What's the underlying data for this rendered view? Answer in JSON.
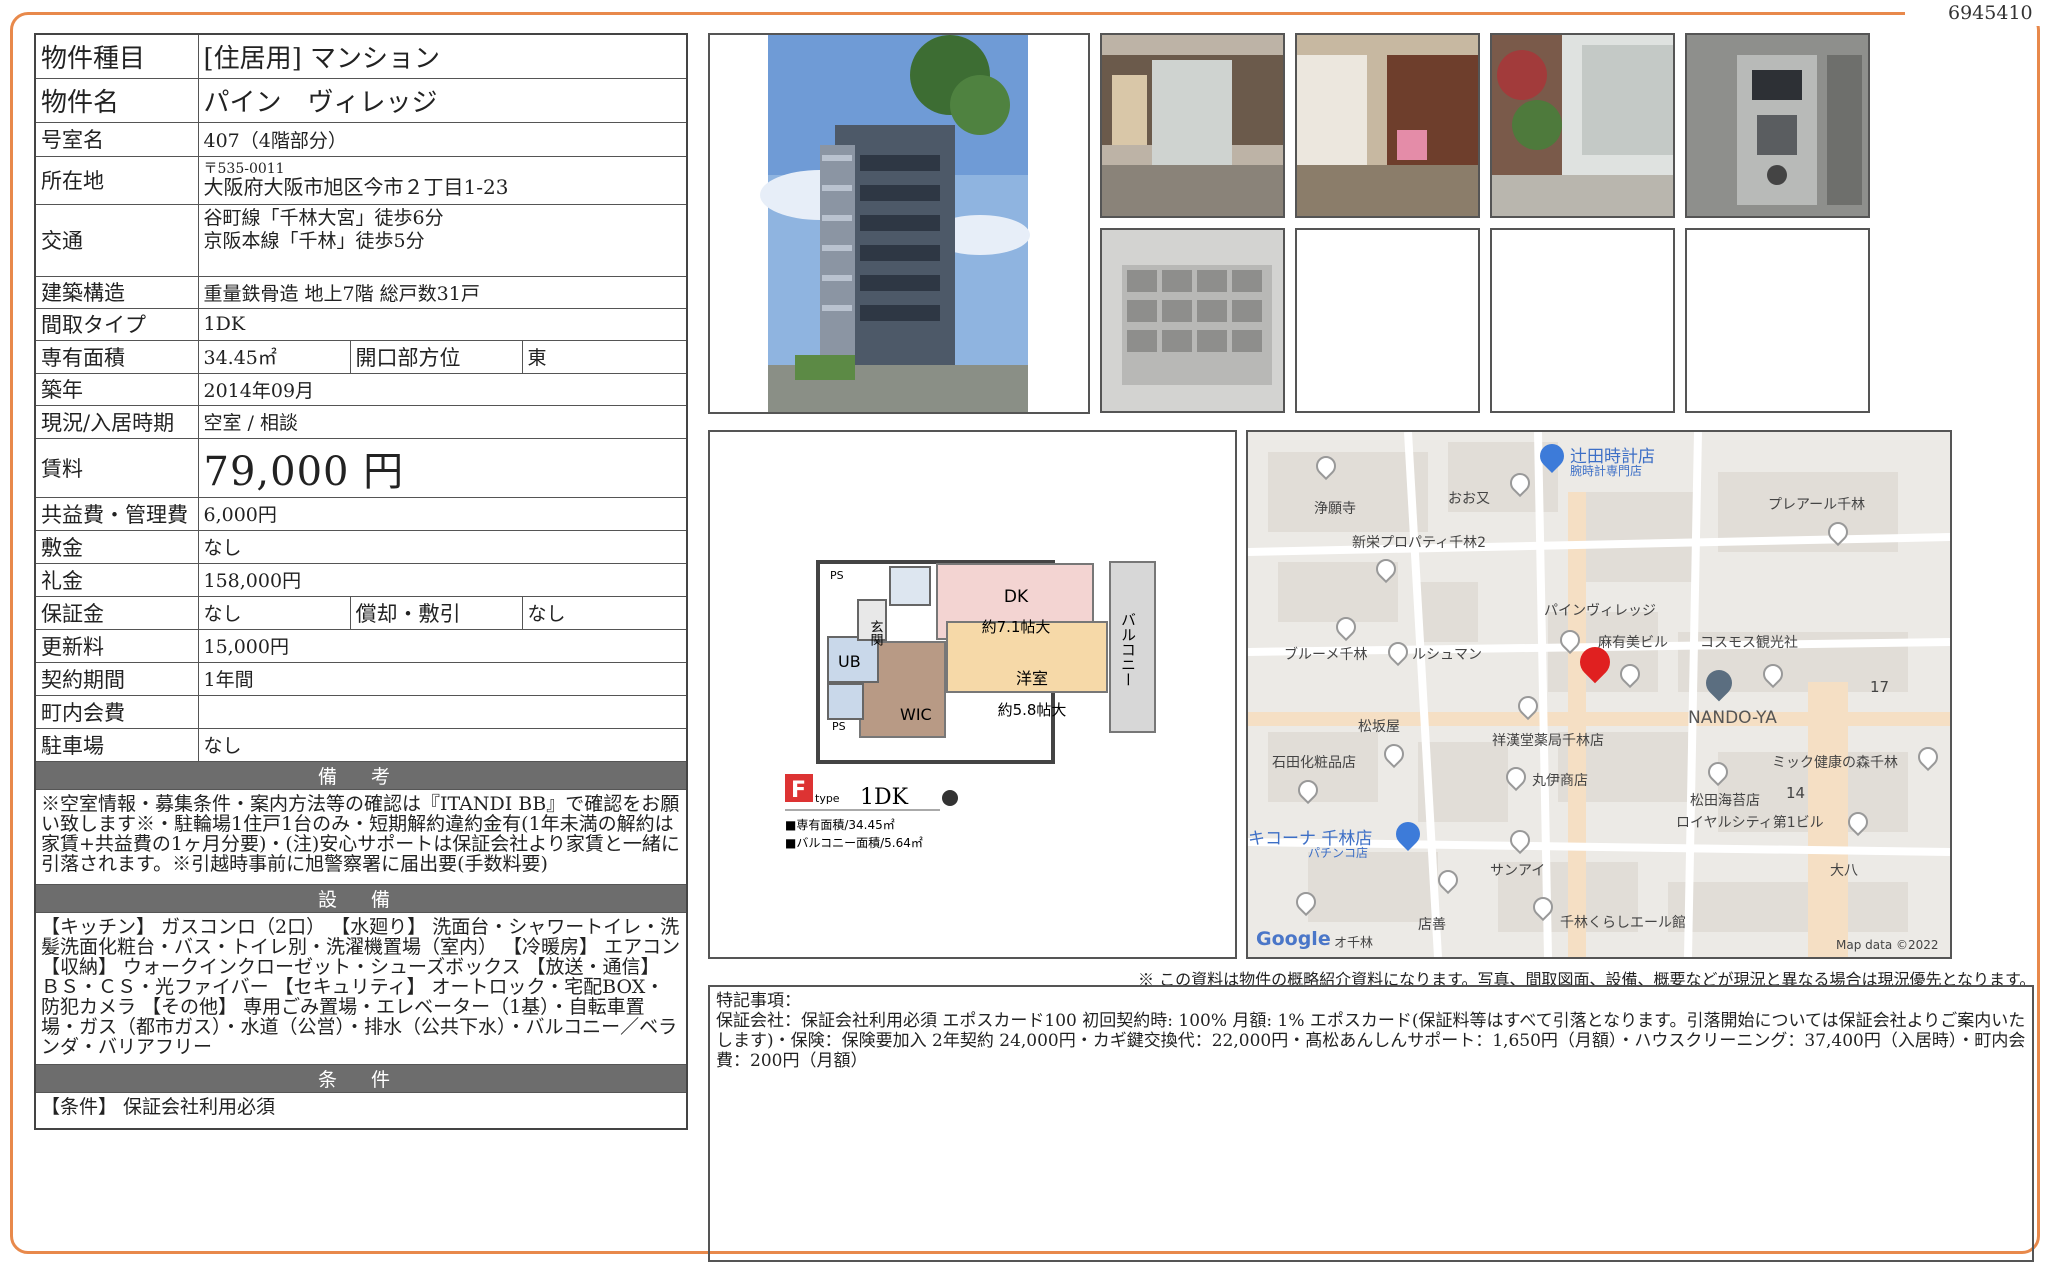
{
  "doc_number": "6945410",
  "spec": {
    "type_label": "物件種目",
    "type_value": "[住居用] マンション",
    "name_label": "物件名",
    "name_value": "パイン　ヴィレッジ",
    "room_label": "号室名",
    "room_value": "407（4階部分）",
    "address_label": "所在地",
    "postal": "〒535-0011",
    "address": "大阪府大阪市旭区今市２丁目1-23",
    "access_label": "交通",
    "access_1": "谷町線「千林大宮」徒歩6分",
    "access_2": "京阪本線「千林」徒歩5分",
    "structure_label": "建築構造",
    "structure_value": "重量鉄骨造 地上7階 総戸数31戸",
    "layout_label": "間取タイプ",
    "layout_value": "1DK",
    "area_label": "専有面積",
    "area_value": "34.45㎡",
    "direction_label": "開口部方位",
    "direction_value": "東",
    "built_label": "築年",
    "built_value": "2014年09月",
    "status_label": "現況/入居時期",
    "status_value": "空室 /  相談",
    "rent_label": "賃料",
    "rent_value": "79,000 円",
    "fee_label": "共益費・管理費",
    "fee_value": "6,000円",
    "deposit_label": "敷金",
    "deposit_value": "なし",
    "key_money_label": "礼金",
    "key_money_value": "158,000円",
    "guarantee_label": "保証金",
    "guarantee_value": "なし",
    "amort_label": "償却・敷引",
    "amort_value": "なし",
    "renewal_label": "更新料",
    "renewal_value": "15,000円",
    "term_label": "契約期間",
    "term_value": "1年間",
    "town_fee_label": "町内会費",
    "town_fee_value": "",
    "parking_label": "駐車場",
    "parking_value": "なし"
  },
  "notes_header": "備 考",
  "notes_text": "※空室情報・募集条件・案内方法等の確認は『ITANDI BB』で確認をお願い致します※・駐輪場1住戸1台のみ・短期解約違約金有(1年未満の解約は家賃+共益費の1ヶ月分要)・(注)安心サポートは保証会社より家賃と一緒に引落されます。※引越時事前に旭警察署に届出要(手数料要)",
  "equipment_header": "設 備",
  "equipment_text": "【キッチン】 ガスコンロ（2口） 【水廻り】 洗面台・シャワートイレ・洗髪洗面化粧台・バス・トイレ別・洗濯機置場（室内） 【冷暖房】 エアコン 【収納】 ウォークインクローゼット・シューズボックス 【放送・通信】 ＢＳ・ＣＳ・光ファイバー 【セキュリティ】 オートロック・宅配BOX・防犯カメラ 【その他】 専用ごみ置場・エレベーター（1基）・自転車置場・ガス（都市ガス）・水道（公営）・排水（公共下水）・バルコニー／ベランダ・バリアフリー",
  "conditions_header": "条 件",
  "conditions_text": "【条件】 保証会社利用必須",
  "floorplan": {
    "dk_label": "DK",
    "dk_size": "約7.1帖大",
    "room_label": "洋室",
    "room_size": "約5.8帖大",
    "balcony_label": "バルコニー",
    "entrance": "玄関",
    "ub": "UB",
    "wic": "WIC",
    "ps1": "PS",
    "ps2": "PS",
    "type_letter": "F",
    "type_word": "type",
    "type_name": "1DK",
    "area_line": "■専有面積/34.45㎡",
    "balcony_line": "■バルコニー面積/5.64㎡"
  },
  "map": {
    "labels": [
      "辻田時計店",
      "腕時計専門店",
      "浄願寺",
      "おお又",
      "プレアール千林",
      "新栄プロパティ千林2",
      "パインヴィレッジ",
      "ブルーメ千林",
      "ルシュマン",
      "麻有美ビル",
      "コスモス観光社",
      "NANDO-YA",
      "17",
      "松坂屋",
      "祥漢堂薬局千林店",
      "石田化粧品店",
      "丸伊商店",
      "ミック健康の森千林",
      "14",
      "松田海苔店",
      "ロイヤルシティ第1ビル",
      "キコーナ 千林店",
      "パチンコ店",
      "サンアイ",
      "大八",
      "店善",
      "千林くらしエール館",
      "Google",
      "オ千林",
      "Map data ©2022"
    ]
  },
  "caption": "※ この資料は物件の概略紹介資料になります。写真、間取図面、設備、概要などが現況と異なる場合は現況優先となります。",
  "remarks": {
    "title": "特記事項：",
    "body": "保証会社：保証会社利用必須 エポスカード100 初回契約時: 100% 月額: 1% エポスカード(保証料等はすべて引落となります。引落開始については保証会社よりご案内いたします)・保険：保険要加入 2年契約 24,000円・カギ鍵交換代：22,000円・髙松あんしんサポート：1,650円（月額）・ハウスクリーニング：37,400円（入居時）・町内会費：200円（月額）"
  }
}
